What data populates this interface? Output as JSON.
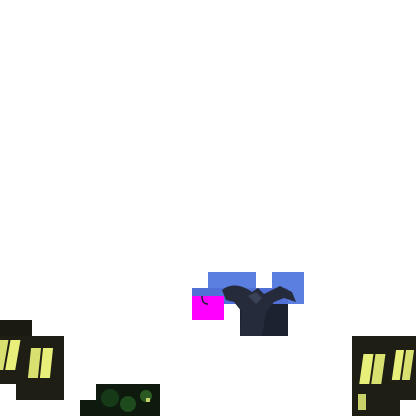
{
  "scene": {
    "background_color": "#ffffff",
    "sky_color": "#5a7fe0",
    "highlight_color": "#ff00ff",
    "window_glow_color": "#e8f07a",
    "shadow_color": "#141414",
    "foliage_color": "#0f2a14"
  },
  "icons": {
    "windows_left": "lit-windows-icon",
    "windows_right": "lit-windows-icon",
    "statue": "statue-silhouette-icon",
    "marker": "magenta-marker-icon",
    "bush": "bush-icon"
  }
}
